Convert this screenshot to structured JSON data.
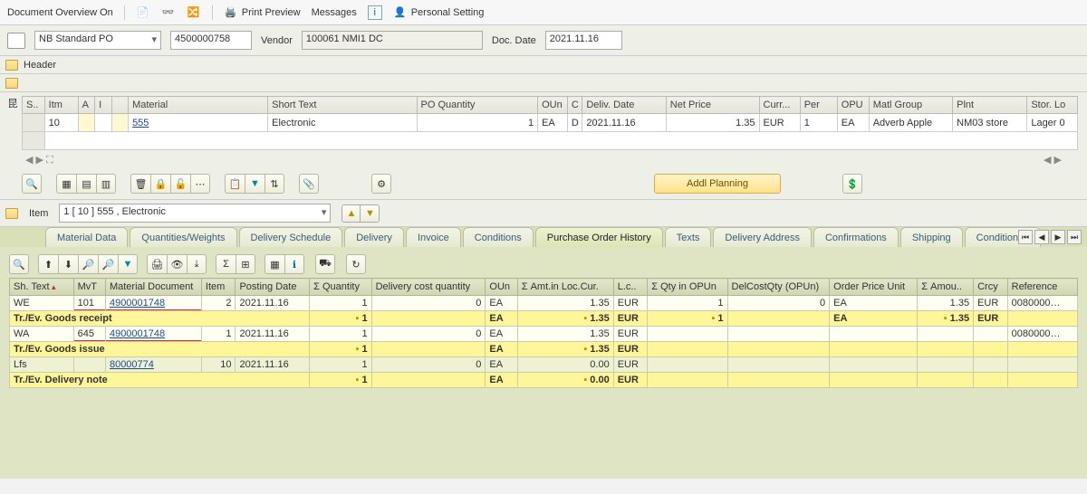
{
  "topmenu": {
    "doc_overview": "Document Overview On",
    "print_preview": "Print Preview",
    "messages": "Messages",
    "personal_setting": "Personal Setting"
  },
  "po": {
    "type": "NB Standard PO",
    "number": "4500000758",
    "vendor_label": "Vendor",
    "vendor_value": "100061 NMI1 DC",
    "docdate_label": "Doc. Date",
    "docdate_value": "2021.11.16",
    "header_label": "Header"
  },
  "items_grid": {
    "cols": [
      "S..",
      "Itm",
      "A",
      "I",
      "",
      "Material",
      "Short Text",
      "PO Quantity",
      "OUn",
      "C",
      "Deliv. Date",
      "Net Price",
      "Curr...",
      "Per",
      "OPU",
      "Matl Group",
      "Plnt",
      "Stor. Lo"
    ],
    "row": {
      "itm": "10",
      "material": "555",
      "short": "Electronic",
      "qty": "1",
      "oun": "EA",
      "c": "D",
      "deliv": "2021.11.16",
      "price": "1.35",
      "curr": "EUR",
      "per": "1",
      "opu": "EA",
      "mgrp": "Adverb Apple",
      "plnt": "NM03 store",
      "stor": "Lager 0"
    }
  },
  "addl_planning": "Addl Planning",
  "itembar": {
    "label": "Item",
    "value": "1 [ 10 ] 555 , Electronic"
  },
  "tabs": [
    "Material Data",
    "Quantities/Weights",
    "Delivery Schedule",
    "Delivery",
    "Invoice",
    "Conditions",
    "Purchase Order History",
    "Texts",
    "Delivery Address",
    "Confirmations",
    "Shipping",
    "Condition ..."
  ],
  "active_tab": 6,
  "hist": {
    "cols": [
      "Sh. Text",
      "MvT",
      "Material Document",
      "Item",
      "Posting Date",
      "Quantity",
      "Delivery cost quantity",
      "OUn",
      "Amt.in Loc.Cur.",
      "L.c..",
      "Qty in OPUn",
      "DelCostQty (OPUn)",
      "Order Price Unit",
      "Amou..",
      "Crcy",
      "Reference"
    ],
    "rows": [
      {
        "type": "data",
        "sh": "WE",
        "mvt": "101",
        "mdoc": "4900001748",
        "item": "2",
        "pdate": "2021.11.16",
        "qty": "1",
        "dcq": "0",
        "oun": "EA",
        "amt": "1.35",
        "lc": "EUR",
        "qopun": "1",
        "dcqopun": "0",
        "opu": "EA",
        "amou": "1.35",
        "crcy": "EUR",
        "ref": "0080000…",
        "red": true
      },
      {
        "type": "sum",
        "sh": "Tr./Ev. Goods receipt",
        "qty": "1",
        "oun": "EA",
        "amt": "1.35",
        "lc": "EUR",
        "qopun": "1",
        "opu": "EA",
        "amou": "1.35",
        "crcy": "EUR"
      },
      {
        "type": "data",
        "sh": "WA",
        "mvt": "645",
        "mdoc": "4900001748",
        "item": "1",
        "pdate": "2021.11.16",
        "qty": "1",
        "dcq": "0",
        "oun": "EA",
        "amt": "1.35",
        "lc": "EUR",
        "ref": "0080000…",
        "red": true
      },
      {
        "type": "sum",
        "sh": "Tr./Ev. Goods issue",
        "qty": "1",
        "oun": "EA",
        "amt": "1.35",
        "lc": "EUR"
      },
      {
        "type": "data",
        "sh": "Lfs",
        "mdoc": "80000774",
        "item": "10",
        "pdate": "2021.11.16",
        "qty": "1",
        "dcq": "0",
        "oun": "EA",
        "amt": "0.00",
        "lc": "EUR",
        "grey": true
      },
      {
        "type": "sum",
        "sh": "Tr./Ev. Delivery note",
        "qty": "1",
        "oun": "EA",
        "amt": "0.00",
        "lc": "EUR"
      }
    ]
  }
}
